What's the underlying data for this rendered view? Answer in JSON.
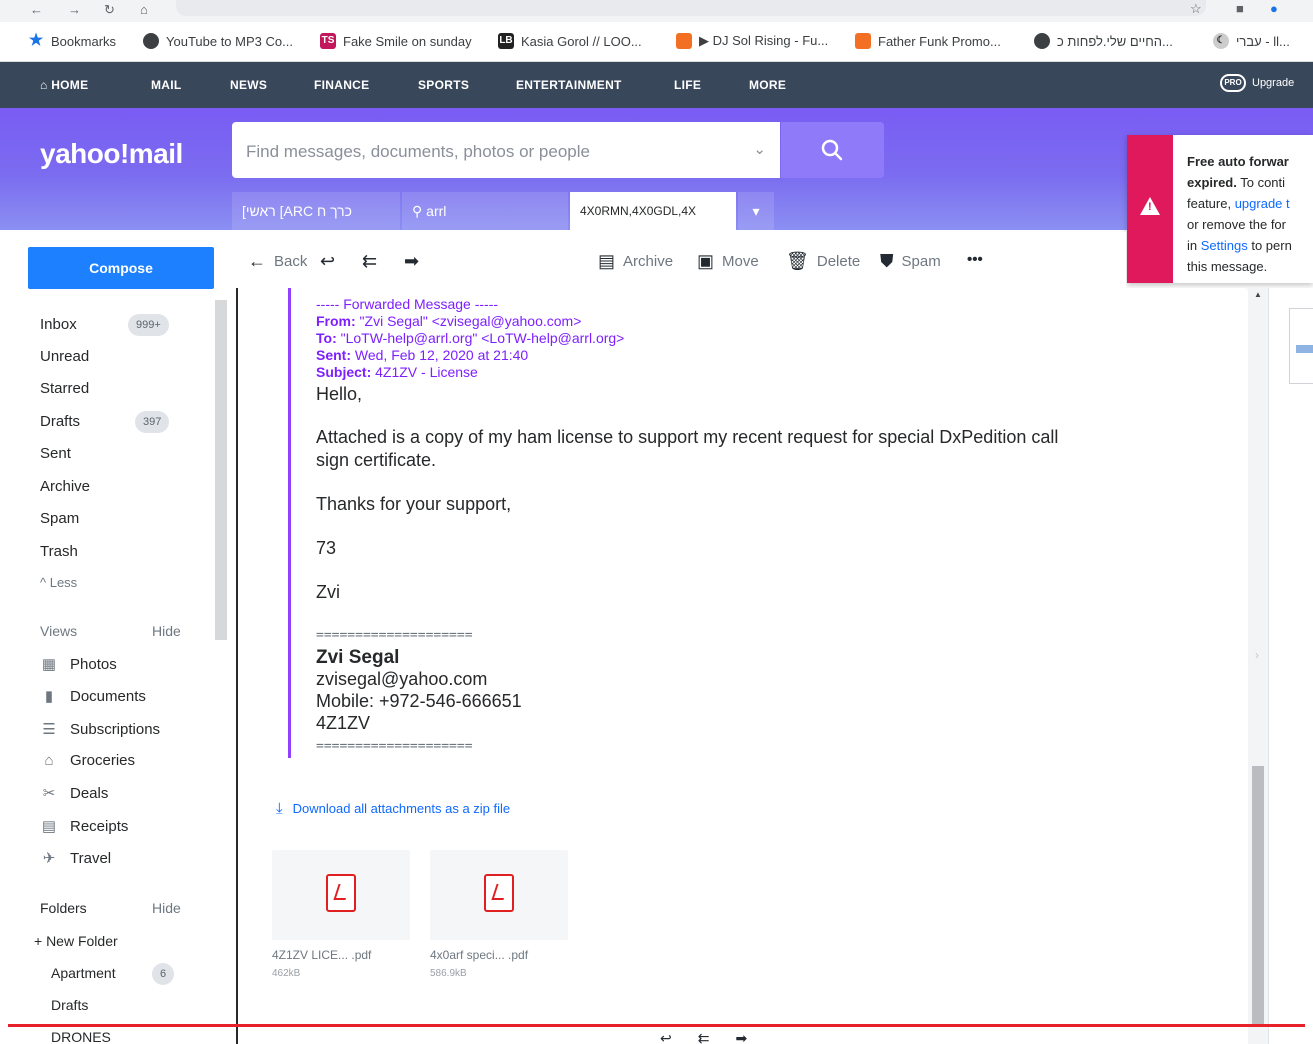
{
  "browser": {
    "bookmarks": [
      {
        "label": "Bookmarks",
        "icon": "star-icon"
      },
      {
        "label": "YouTube to MP3 Co...",
        "icon": "globe-icon"
      },
      {
        "label": "Fake Smile on sunday",
        "icon": "ts-icon"
      },
      {
        "label": "Kasia Gorol // LOO...",
        "icon": "lb-icon"
      },
      {
        "label": "▶ DJ Sol Rising - Fu...",
        "icon": "soundcloud-icon"
      },
      {
        "label": "Father Funk Promo...",
        "icon": "soundcloud-icon"
      },
      {
        "label": "החיים שלי.לפחות כ...",
        "icon": "globe-icon"
      },
      {
        "label": "עברי - ll...",
        "icon": "moon-icon"
      }
    ]
  },
  "topnav": {
    "items": [
      "HOME",
      "MAIL",
      "NEWS",
      "FINANCE",
      "SPORTS",
      "ENTERTAINMENT",
      "LIFE",
      "MORE"
    ],
    "upgrade": "Upgrade",
    "pro_badge": "PRO"
  },
  "header": {
    "logo": "yahoo!mail",
    "search_placeholder": "Find messages, documents, photos or people",
    "tabs": [
      "כרך ח ARC] ראשי]",
      "arrl",
      "4X0RMN,4X0GDL,4X",
      "▾"
    ]
  },
  "notice": {
    "line1": "Free auto forwar",
    "line2_bold": "expired.",
    "line2_rest": " To conti",
    "line3_a": "feature, ",
    "line3_link": "upgrade t",
    "line4": "or remove the for",
    "line5_a": "in ",
    "line5_link": "Settings",
    "line5_b": " to pern",
    "line6": "this message."
  },
  "toolbar": {
    "back": "Back",
    "archive": "Archive",
    "move": "Move",
    "delete": "Delete",
    "spam": "Spam",
    "more": "•••"
  },
  "sidebar": {
    "compose": "Compose",
    "folders": [
      {
        "label": "Inbox",
        "count": "999+"
      },
      {
        "label": "Unread",
        "count": ""
      },
      {
        "label": "Starred",
        "count": ""
      },
      {
        "label": "Drafts",
        "count": "397"
      },
      {
        "label": "Sent",
        "count": ""
      },
      {
        "label": "Archive",
        "count": ""
      },
      {
        "label": "Spam",
        "count": ""
      },
      {
        "label": "Trash",
        "count": ""
      }
    ],
    "less": "^ Less",
    "views_label": "Views",
    "views_hide": "Hide",
    "views": [
      "Photos",
      "Documents",
      "Subscriptions",
      "Groceries",
      "Deals",
      "Receipts",
      "Travel"
    ],
    "folders_label": "Folders",
    "folders_hide": "Hide",
    "new_folder": "+ New Folder",
    "custom_folders": [
      {
        "label": "Apartment",
        "count": "6"
      },
      {
        "label": "Drafts",
        "count": ""
      },
      {
        "label": "DRONES",
        "count": ""
      }
    ]
  },
  "message": {
    "fwd_header": "----- Forwarded Message -----",
    "from_label": "From:",
    "from_value": " \"Zvi Segal\" <zvisegal@yahoo.com>",
    "to_label": "To:",
    "to_value": " \"LoTW-help@arrl.org\" <LoTW-help@arrl.org>",
    "sent_label": "Sent:",
    "sent_value": " Wed, Feb 12, 2020 at 21:40",
    "subject_label": "Subject:",
    "subject_value": " 4Z1ZV - License",
    "greeting": "Hello,",
    "para1_line1": "Attached is a copy of my ham license to support my recent request for special DxPedition call",
    "para1_line2": "sign certificate.",
    "thanks": "Thanks for your support,",
    "seventy_three": "73",
    "name": "Zvi",
    "separator": "====================",
    "sig_name": "Zvi Segal",
    "sig_email": "zvisegal@yahoo.com",
    "sig_mobile": "Mobile: +972-546-666651",
    "sig_call": "4Z1ZV",
    "download_all": "Download all attachments as a zip file",
    "attachments": [
      {
        "name": "4Z1ZV LICE... .pdf",
        "size": "462kB"
      },
      {
        "name": "4x0arf speci... .pdf",
        "size": "586.9kB"
      }
    ]
  }
}
